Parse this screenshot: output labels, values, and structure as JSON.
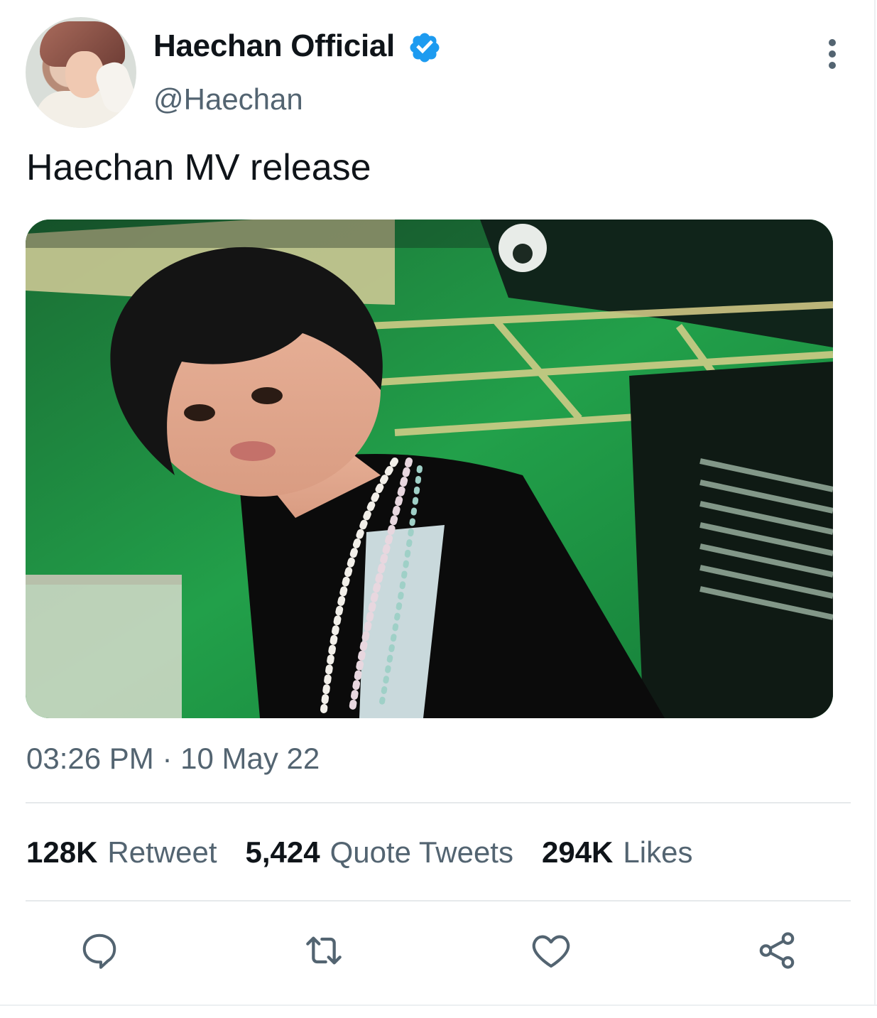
{
  "tweet": {
    "author": {
      "display_name": "Haechan Official",
      "handle": "@Haechan",
      "verified": true,
      "avatar": "profile-photo"
    },
    "text": "Haechan MV release",
    "media": "photo",
    "timestamp": "03:26 PM · 10 May 22",
    "stats": [
      {
        "count": "128K",
        "label": "Retweet"
      },
      {
        "count": "5,424",
        "label": "Quote Tweets"
      },
      {
        "count": "294K",
        "label": "Likes"
      }
    ],
    "actions": [
      "reply-icon",
      "retweet-icon",
      "like-icon",
      "share-icon"
    ]
  },
  "colors": {
    "text_primary": "#0f1419",
    "text_secondary": "#536471",
    "verified_blue": "#1d9bf0",
    "icon_gray": "#536471",
    "divider": "#e6e9eb"
  }
}
